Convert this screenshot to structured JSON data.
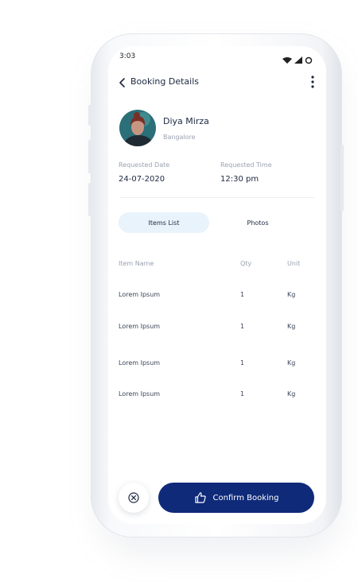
{
  "status_bar": {
    "time": "3:03"
  },
  "header": {
    "title": "Booking Details"
  },
  "profile": {
    "name": "Diya Mirza",
    "location": "Bangalore"
  },
  "request": {
    "date_label": "Requested Date",
    "date_value": "24-07-2020",
    "time_label": "Requested Time",
    "time_value": "12:30 pm"
  },
  "tabs": [
    {
      "label": "Items List",
      "active": true
    },
    {
      "label": "Photos",
      "active": false
    }
  ],
  "table": {
    "headers": [
      "Item Name",
      "Qty",
      "Unit"
    ],
    "rows": [
      [
        "Lorem Ipsum",
        "1",
        "Kg"
      ],
      [
        "Lorem Ipsum",
        "1",
        "Kg"
      ],
      [
        "Lorem Ipsum",
        "1",
        "Kg"
      ],
      [
        "Lorem Ipsum",
        "1",
        "Kg"
      ]
    ]
  },
  "actions": {
    "confirm_label": "Confirm Booking"
  },
  "colors": {
    "primary": "#0f2a79",
    "tab_active_bg": "#e9f3fb",
    "muted": "#9aa2b1"
  }
}
